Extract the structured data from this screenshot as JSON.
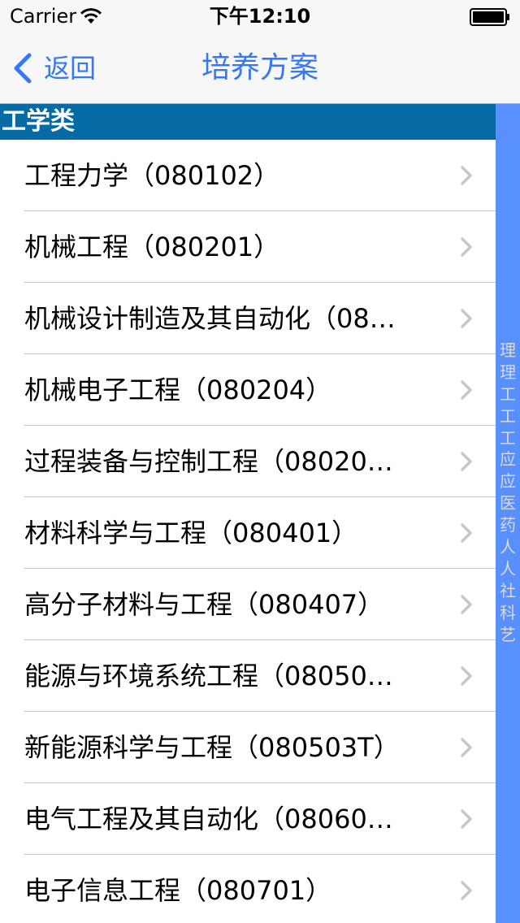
{
  "status_bar": {
    "carrier": "Carrier",
    "time": "下午12:10",
    "wifi_icon": "wifi-icon",
    "battery_icon": "battery-icon"
  },
  "nav": {
    "back_label": "返回",
    "title": "培养方案",
    "accent_color": "#3478f6"
  },
  "section": {
    "title": "工学类",
    "color": "#066aa5"
  },
  "items": [
    {
      "label": "工程力学（080102）"
    },
    {
      "label": "机械工程（080201）"
    },
    {
      "label": "机械设计制造及其自动化（08…"
    },
    {
      "label": "机械电子工程（080204）"
    },
    {
      "label": "过程装备与控制工程（08020…"
    },
    {
      "label": "材料科学与工程（080401）"
    },
    {
      "label": "高分子材料与工程（080407）"
    },
    {
      "label": "能源与环境系统工程（08050…"
    },
    {
      "label": "新能源科学与工程（080503T）"
    },
    {
      "label": "电气工程及其自动化（08060…"
    },
    {
      "label": "电子信息工程（080701）"
    }
  ],
  "index": {
    "color": "#5890ff",
    "entries": [
      "理",
      "理",
      "工",
      "工",
      "工",
      "应",
      "应",
      "医",
      "药",
      "人",
      "人",
      "社",
      "科",
      "艺"
    ]
  }
}
